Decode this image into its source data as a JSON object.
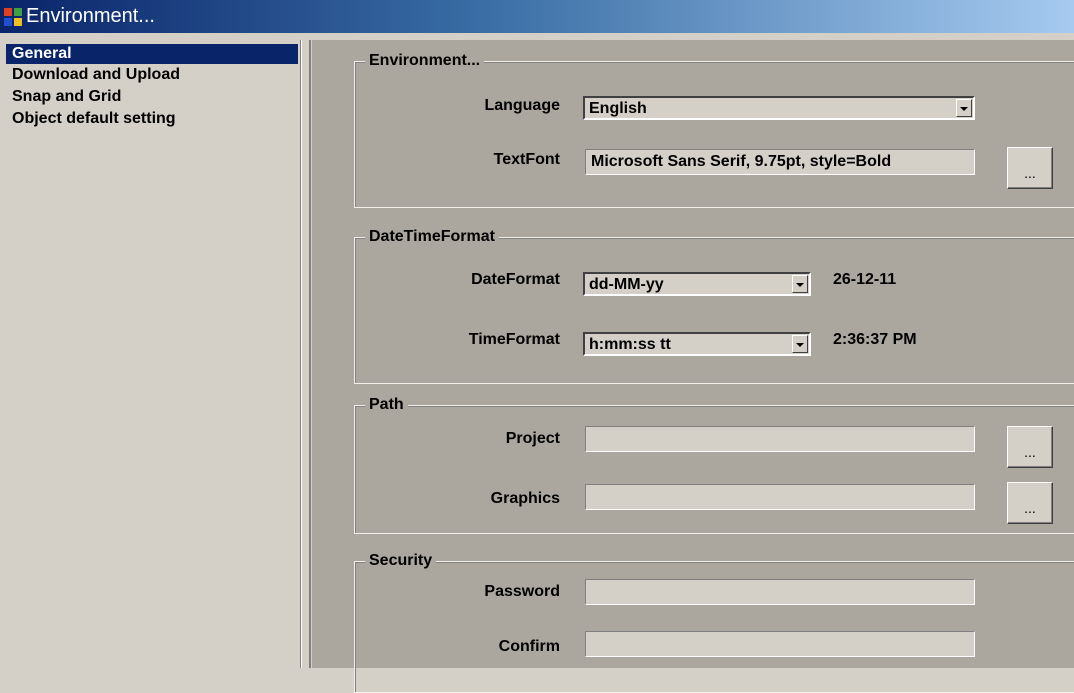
{
  "window": {
    "title": "Environment..."
  },
  "sidebar": {
    "items": [
      {
        "label": "General",
        "selected": true
      },
      {
        "label": "Download and Upload",
        "selected": false
      },
      {
        "label": "Snap and Grid",
        "selected": false
      },
      {
        "label": "Object default setting",
        "selected": false
      }
    ]
  },
  "environment": {
    "legend": "Environment...",
    "language_label": "Language",
    "language_value": "English",
    "textfont_label": "TextFont",
    "textfont_value": "Microsoft Sans Serif, 9.75pt, style=Bold",
    "textfont_button": "..."
  },
  "datetime": {
    "legend": "DateTimeFormat",
    "date_label": "DateFormat",
    "date_value": "dd-MM-yy",
    "date_preview": "26-12-11",
    "time_label": "TimeFormat",
    "time_value": "h:mm:ss tt",
    "time_preview": "2:36:37 PM"
  },
  "path": {
    "legend": "Path",
    "project_label": "Project",
    "project_value": "",
    "project_button": "...",
    "graphics_label": "Graphics",
    "graphics_value": "",
    "graphics_button": "..."
  },
  "security": {
    "legend": "Security",
    "password_label": "Password",
    "password_value": "",
    "confirm_label": "Confirm",
    "confirm_value": ""
  },
  "colors": {
    "titlebar_start": "#0a246a",
    "selection": "#0a246a",
    "panel": "#aba79e"
  }
}
